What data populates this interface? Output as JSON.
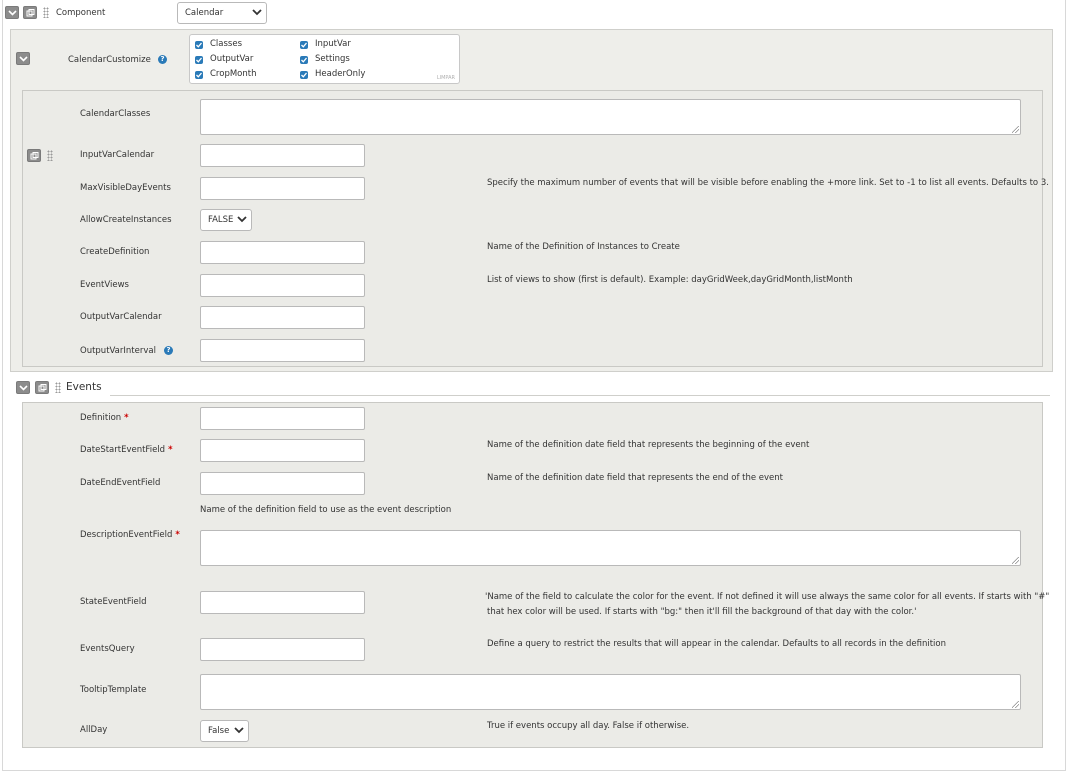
{
  "component": {
    "label": "Component",
    "select_value": "Calendar"
  },
  "customize": {
    "label": "CalendarCustomize",
    "options": [
      {
        "label": "Classes",
        "checked": true
      },
      {
        "label": "OutputVar",
        "checked": true
      },
      {
        "label": "CropMonth",
        "checked": true
      },
      {
        "label": "InputVar",
        "checked": true
      },
      {
        "label": "Settings",
        "checked": true
      },
      {
        "label": "HeaderOnly",
        "checked": true
      }
    ],
    "clear_label": "LIMPAR"
  },
  "calendar_fields": {
    "classes": {
      "label": "CalendarClasses"
    },
    "input_var": {
      "label": "InputVarCalendar"
    },
    "max_visible": {
      "label": "MaxVisibleDayEvents",
      "description": "Specify the maximum number of events that will be visible before enabling the +more link. Set to -1 to list all events. Defaults to 3."
    },
    "allow_create": {
      "label": "AllowCreateInstances",
      "select_value": "FALSE"
    },
    "create_definition": {
      "label": "CreateDefinition",
      "description": "Name of the Definition of Instances to Create"
    },
    "event_views": {
      "label": "EventViews",
      "description": "List of views to show (first is default). Example: dayGridWeek,dayGridMonth,listMonth"
    },
    "output_var": {
      "label": "OutputVarCalendar"
    },
    "output_interval": {
      "label": "OutputVarInterval"
    }
  },
  "events": {
    "title": "Events",
    "definition": {
      "label": "Definition",
      "required": "*"
    },
    "date_start": {
      "label": "DateStartEventField",
      "required": "*",
      "description": "Name of the definition date field that represents the beginning of the event"
    },
    "date_end": {
      "label": "DateEndEventField",
      "description": "Name of the definition date field that represents the end of the event"
    },
    "description_field": {
      "label": "DescriptionEventField",
      "required": "*",
      "hint": "Name of the definition field to use as the event description"
    },
    "state_field": {
      "label": "StateEventField",
      "description_line1": "'Name of the field to calculate the color for the event. If not defined it will use always the same color for all events. If starts with \"#\"",
      "description_line2": "that hex color will be used. If starts with \"bg:\" then it'll fill the background of that day with the color.'"
    },
    "events_query": {
      "label": "EventsQuery",
      "description": "Define a query to restrict the results that will appear in the calendar. Defaults to all records in the definition"
    },
    "tooltip": {
      "label": "TooltipTemplate"
    },
    "all_day": {
      "label": "AllDay",
      "select_value": "False",
      "description": "True if events occupy all day. False if otherwise."
    }
  },
  "colors": {
    "accent": "#2a7ab8",
    "panel_bg": "#eeeeea",
    "required": "#cc0000"
  }
}
